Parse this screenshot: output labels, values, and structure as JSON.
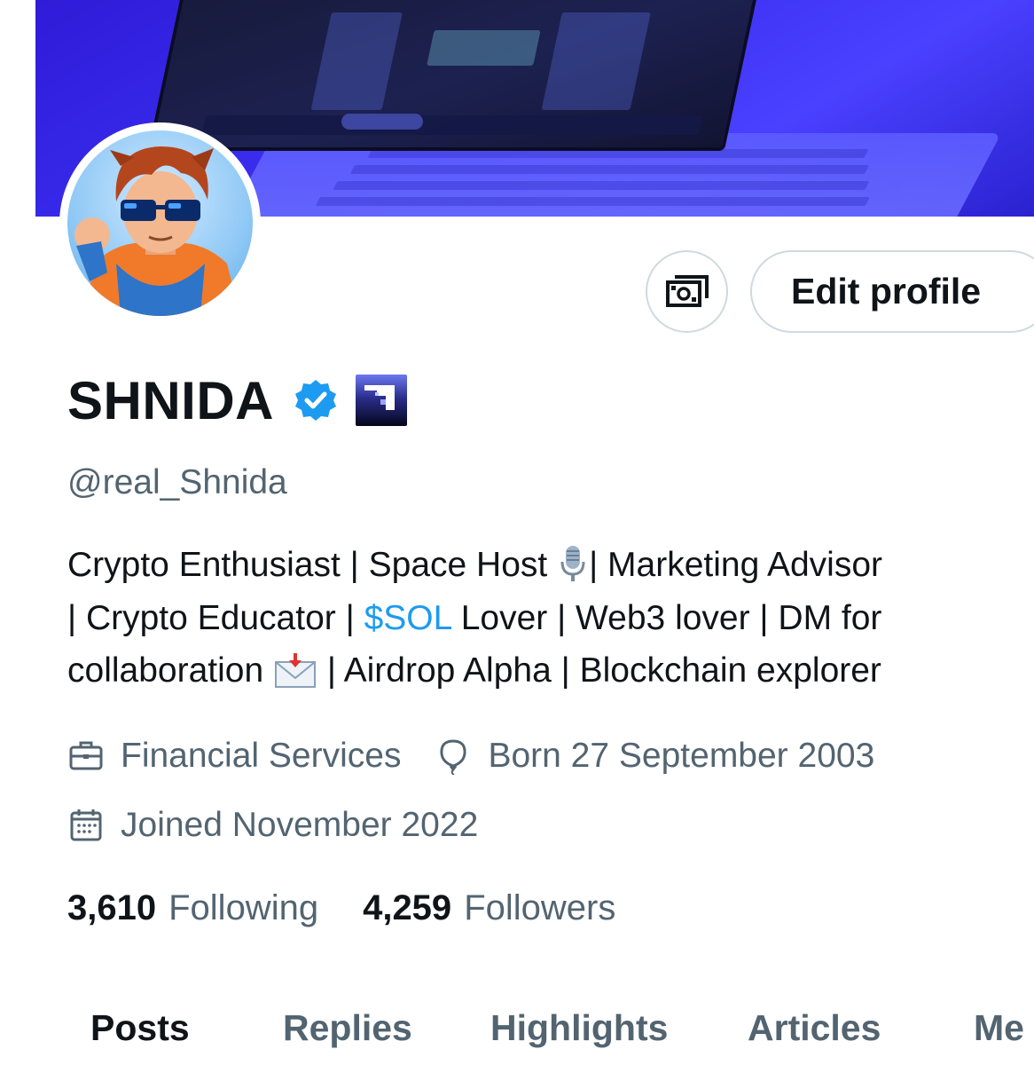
{
  "profile": {
    "display_name": "SHNIDA",
    "handle": "@real_Shnida",
    "verified": true,
    "bio": {
      "line1_a": "Crypto Enthusiast | Space Host ",
      "line1_b": "| Marketing Advisor",
      "line2_a": "| Crypto Educator | ",
      "line2_cashtag": "$SOL",
      "line2_b": " Lover | Web3 lover | DM for",
      "line3_a": "collaboration ",
      "line3_b": " | Airdrop Alpha | Blockchain explorer"
    },
    "category": "Financial Services",
    "birthday": "Born 27 September 2003",
    "joined": "Joined November 2022",
    "following_count": "3,610",
    "following_label": "Following",
    "followers_count": "4,259",
    "followers_label": "Followers"
  },
  "actions": {
    "monetization_icon": "money-icon",
    "edit_profile_label": "Edit profile"
  },
  "tabs": [
    {
      "label": "Posts",
      "active": true
    },
    {
      "label": "Replies",
      "active": false
    },
    {
      "label": "Highlights",
      "active": false
    },
    {
      "label": "Articles",
      "active": false
    },
    {
      "label": "Me",
      "active": false
    }
  ],
  "colors": {
    "accent": "#1d9bf0",
    "text_primary": "#0f1419",
    "text_secondary": "#536471",
    "border": "#cfd9de",
    "banner": "#3a2ef0"
  }
}
